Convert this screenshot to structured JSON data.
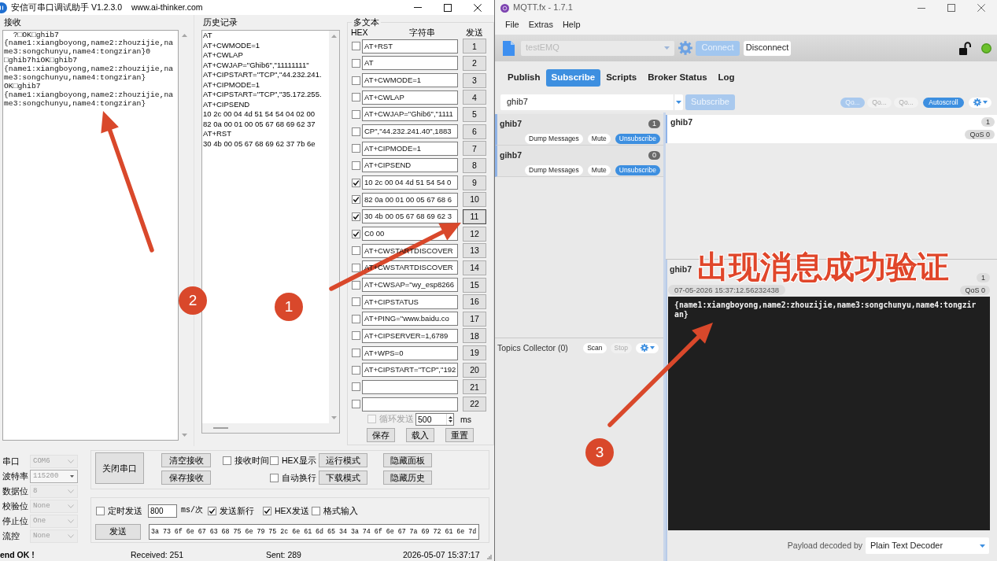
{
  "serial_window": {
    "title": "安信可串口调试助手 V1.2.3.0",
    "website": "www.ai-thinker.com",
    "receive": {
      "label": "接收",
      "lines": [
        "  ?□OK□ghib7",
        "{name1:xiangboyong,name2:zhouzijie,na",
        "me3:songchunyu,name4:tongziran}0",
        "□ghib7hiOK□ghib7",
        "{name1:xiangboyong,name2:zhouzijie,na",
        "me3:songchunyu,name4:tongziran}",
        "OK□ghib7",
        "{name1:xiangboyong,name2:zhouzijie,na",
        "me3:songchunyu,name4:tongziran}"
      ]
    },
    "history": {
      "label": "历史记录",
      "lines": [
        "AT",
        "AT+CWMODE=1",
        "AT+CWLAP",
        "AT+CWJAP=\"Ghib6\",\"11111111\"",
        "AT+CIPSTART=\"TCP\",\"44.232.241.",
        "AT+CIPMODE=1",
        "AT+CIPSTART=\"TCP\",\"35.172.255.",
        "AT+CIPSEND",
        "10 2c 00 04 4d 51 54 54 04 02 00",
        "82 0a 00 01 00 05 67 68 69 62 37",
        "AT+RST",
        "30 4b 00 05 67 68 69 62 37 7b 6e"
      ]
    },
    "multi_text": {
      "label": "多文本",
      "headers": [
        "HEX",
        "字符串",
        "发送"
      ],
      "rows": [
        {
          "checked": false,
          "text": "AT+RST",
          "send": "1",
          "focused": false
        },
        {
          "checked": false,
          "text": "AT",
          "send": "2",
          "focused": false
        },
        {
          "checked": false,
          "text": "AT+CWMODE=1",
          "send": "3",
          "focused": false
        },
        {
          "checked": false,
          "text": "AT+CWLAP",
          "send": "4",
          "focused": false
        },
        {
          "checked": false,
          "text": "AT+CWJAP=\"Ghib6\",\"1111",
          "send": "5",
          "focused": false
        },
        {
          "checked": false,
          "text": "CP\",\"44.232.241.40\",1883",
          "send": "6",
          "focused": false
        },
        {
          "checked": false,
          "text": "AT+CIPMODE=1",
          "send": "7",
          "focused": false
        },
        {
          "checked": false,
          "text": "AT+CIPSEND",
          "send": "8",
          "focused": false
        },
        {
          "checked": true,
          "text": "10 2c 00 04 4d 51 54 54 0",
          "send": "9",
          "focused": false
        },
        {
          "checked": true,
          "text": "82 0a 00 01 00 05 67 68 6",
          "send": "10",
          "focused": false
        },
        {
          "checked": true,
          "text": "30 4b 00 05 67 68 69 62 3",
          "send": "11",
          "focused": true
        },
        {
          "checked": true,
          "text": "C0 00",
          "send": "12",
          "focused": false
        },
        {
          "checked": false,
          "text": "AT+CWSTARTDISCOVER",
          "send": "13",
          "focused": false
        },
        {
          "checked": false,
          "text": "AT+CWSTARTDISCOVER",
          "send": "14",
          "focused": false
        },
        {
          "checked": false,
          "text": "AT+CWSAP=\"wy_esp8266",
          "send": "15",
          "focused": false
        },
        {
          "checked": false,
          "text": "AT+CIPSTATUS",
          "send": "16",
          "focused": false
        },
        {
          "checked": false,
          "text": "AT+PING=\"www.baidu.co",
          "send": "17",
          "focused": false
        },
        {
          "checked": false,
          "text": "AT+CIPSERVER=1,6789",
          "send": "18",
          "focused": false
        },
        {
          "checked": false,
          "text": "AT+WPS=0",
          "send": "19",
          "focused": false
        },
        {
          "checked": false,
          "text": "AT+CIPSTART=\"TCP\",\"192",
          "send": "20",
          "focused": false
        },
        {
          "checked": false,
          "send": "21",
          "focused": false
        },
        {
          "checked": false,
          "send": "22",
          "focused": false
        }
      ],
      "loop_send": {
        "label": "循环发送",
        "checked": false,
        "disabled": true
      },
      "interval": "500",
      "unit": "ms",
      "buttons": [
        "保存",
        "载入",
        "重置"
      ]
    },
    "port_settings": [
      {
        "label": "串口",
        "value": "COM6",
        "kind": "dropdown",
        "disabled": true
      },
      {
        "label": "波特率",
        "value": "115200",
        "kind": "combo",
        "disabled": true
      },
      {
        "label": "数据位",
        "value": "8",
        "kind": "dropdown",
        "disabled": true
      },
      {
        "label": "校验位",
        "value": "None",
        "kind": "dropdown",
        "disabled": true
      },
      {
        "label": "停止位",
        "value": "One",
        "kind": "dropdown",
        "disabled": true
      },
      {
        "label": "流控",
        "value": "None",
        "kind": "dropdown",
        "disabled": true
      }
    ],
    "controls": {
      "port_button": "关闭串口",
      "receive_buttons": [
        "清空接收",
        "保存接收"
      ],
      "options": [
        {
          "label": "接收时间",
          "checked": false
        },
        {
          "label": "HEX显示",
          "checked": false
        },
        {
          "label": "自动换行",
          "checked": false
        }
      ],
      "mode_buttons": [
        "运行模式",
        "下载模式"
      ],
      "panel_buttons": [
        "隐藏面板",
        "隐藏历史"
      ]
    },
    "send": {
      "timed": {
        "label": "定时发送",
        "checked": false
      },
      "period": "800",
      "period_unit": "ms/次",
      "options": [
        {
          "label": "发送新行",
          "checked": true
        },
        {
          "label": "HEX发送",
          "checked": true
        },
        {
          "label": "格式输入",
          "checked": false
        }
      ],
      "button": "发送",
      "value": "3a 73 6f 6e 67 63 68 75 6e 79 75 2c 6e 61 6d 65 34 3a 74 6f 6e 67 7a 69 72 61 6e 7d"
    },
    "status_bar": {
      "message": "end OK !",
      "received": "Received: 251",
      "sent": "Sent: 289",
      "time": "2026-05-07 15:37:17"
    }
  },
  "mqtt_window": {
    "title": "MQTT.fx - 1.7.1",
    "menu": [
      "File",
      "Extras",
      "Help"
    ],
    "toolbar": {
      "profile": "testEMQ",
      "profile_disabled": true,
      "connect": {
        "label": "Connect",
        "disabled": true
      },
      "disconnect": {
        "label": "Disconnect",
        "disabled": false
      },
      "connected": true
    },
    "tabs": [
      {
        "label": "Publish",
        "selected": false
      },
      {
        "label": "Subscribe",
        "selected": true
      },
      {
        "label": "Scripts",
        "selected": false
      },
      {
        "label": "Broker Status",
        "selected": false
      },
      {
        "label": "Log",
        "selected": false
      }
    ],
    "subscribe_bar": {
      "topic": "ghib7",
      "button": {
        "label": "Subscribe",
        "disabled": true
      },
      "qos_buttons": [
        {
          "label": "Qo...",
          "selected": true
        },
        {
          "label": "Qo...",
          "selected": false
        },
        {
          "label": "Qo...",
          "selected": false
        }
      ],
      "autoscroll": {
        "label": "Autoscroll",
        "on": true
      }
    },
    "subscriptions": [
      {
        "topic": "ghib7",
        "count": "1",
        "buttons": [
          {
            "label": "Dump Messages",
            "kind": "plain"
          },
          {
            "label": "Mute",
            "kind": "plain"
          },
          {
            "label": "Unsubscribe",
            "kind": "primary"
          }
        ]
      },
      {
        "topic": "gihb7",
        "count": "0",
        "buttons": [
          {
            "label": "Dump Messages",
            "kind": "plain"
          },
          {
            "label": "Mute",
            "kind": "plain"
          },
          {
            "label": "Unsubscribe",
            "kind": "primary"
          }
        ]
      }
    ],
    "topics_collector": {
      "label": "Topics Collector (0)",
      "scan": {
        "label": "Scan",
        "disabled": false
      },
      "stop": {
        "label": "Stop",
        "disabled": true
      }
    },
    "messages": [
      {
        "topic": "ghib7",
        "number": "1",
        "qos": "QoS 0"
      }
    ],
    "detail": {
      "topic": "ghib7",
      "number": "1",
      "timestamp": "07-05-2026 15:37:12.56232438",
      "qos": "QoS 0",
      "payload": "{name1:xiangboyong,name2:zhouzijie,name3:songchunyu,name4:tongziran}"
    },
    "decoder": {
      "label": "Payload decoded by",
      "value": "Plain Text Decoder"
    }
  },
  "annotations": {
    "callouts": [
      {
        "number": "1"
      },
      {
        "number": "2"
      },
      {
        "number": "3"
      }
    ],
    "caption": "出现消息成功验证"
  }
}
